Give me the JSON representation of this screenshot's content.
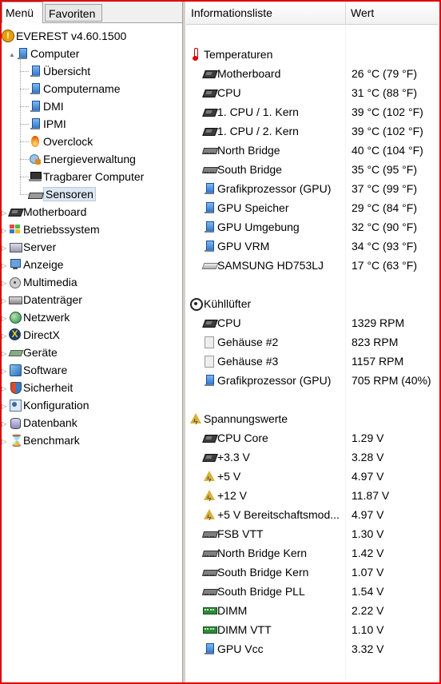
{
  "tabs": {
    "menu": "Menü",
    "favorites": "Favoriten"
  },
  "tree": {
    "root": "EVEREST v4.60.1500",
    "computer": {
      "label": "Computer",
      "children": [
        "Übersicht",
        "Computername",
        "DMI",
        "IPMI",
        "Overclock",
        "Energieverwaltung",
        "Tragbarer Computer",
        "Sensoren"
      ],
      "child_icons": [
        "computer-icon",
        "computer-icon",
        "computer-icon",
        "computer-icon",
        "overclock-flame-icon",
        "power-management-icon",
        "laptop-icon",
        "sensor-icon"
      ]
    },
    "categories": [
      "Motherboard",
      "Betriebssystem",
      "Server",
      "Anzeige",
      "Multimedia",
      "Datenträger",
      "Netzwerk",
      "DirectX",
      "Geräte",
      "Software",
      "Sicherheit",
      "Konfiguration",
      "Datenbank",
      "Benchmark"
    ],
    "category_icons": [
      "motherboard-icon",
      "windows-logo-icon",
      "server-icon",
      "display-icon",
      "multimedia-icon",
      "storage-icon",
      "network-icon",
      "directx-icon",
      "devices-icon",
      "software-icon",
      "security-shield-icon",
      "configuration-icon",
      "database-icon",
      "hourglass-icon"
    ],
    "selected": "Sensoren"
  },
  "list_header": {
    "col1": "Informationsliste",
    "col2": "Wert"
  },
  "sections": {
    "temperatures": {
      "title": "Temperaturen",
      "rows": [
        {
          "label": "Motherboard",
          "value": "26 °C  (79 °F)",
          "icon": "chip-icon"
        },
        {
          "label": "CPU",
          "value": "31 °C  (88 °F)",
          "icon": "cpu-icon"
        },
        {
          "label": "1. CPU / 1. Kern",
          "value": "39 °C  (102 °F)",
          "icon": "cpu-icon"
        },
        {
          "label": "1. CPU / 2. Kern",
          "value": "39 °C  (102 °F)",
          "icon": "cpu-icon"
        },
        {
          "label": "North Bridge",
          "value": "40 °C  (104 °F)",
          "icon": "chipset-icon"
        },
        {
          "label": "South Bridge",
          "value": "35 °C  (95 °F)",
          "icon": "chipset-icon"
        },
        {
          "label": "Grafikprozessor (GPU)",
          "value": "37 °C  (99 °F)",
          "icon": "gpu-icon"
        },
        {
          "label": "GPU Speicher",
          "value": "29 °C  (84 °F)",
          "icon": "gpu-icon"
        },
        {
          "label": "GPU Umgebung",
          "value": "32 °C  (90 °F)",
          "icon": "gpu-icon"
        },
        {
          "label": "GPU VRM",
          "value": "34 °C  (93 °F)",
          "icon": "gpu-icon"
        },
        {
          "label": "SAMSUNG HD753LJ",
          "value": "17 °C  (63 °F)",
          "icon": "hard-drive-icon"
        }
      ]
    },
    "fans": {
      "title": "Kühllüfter",
      "rows": [
        {
          "label": "CPU",
          "value": "1329 RPM",
          "icon": "cpu-icon"
        },
        {
          "label": "Gehäuse #2",
          "value": "823 RPM",
          "icon": "case-icon"
        },
        {
          "label": "Gehäuse #3",
          "value": "1157 RPM",
          "icon": "case-icon"
        },
        {
          "label": "Grafikprozessor (GPU)",
          "value": "705 RPM  (40%)",
          "icon": "gpu-icon"
        }
      ]
    },
    "voltages": {
      "title": "Spannungswerte",
      "rows": [
        {
          "label": "CPU Core",
          "value": "1.29 V",
          "icon": "cpu-icon"
        },
        {
          "label": "+3.3 V",
          "value": "3.28 V",
          "icon": "chip-icon"
        },
        {
          "label": "+5 V",
          "value": "4.97 V",
          "icon": "voltage-warning-icon"
        },
        {
          "label": "+12 V",
          "value": "11.87 V",
          "icon": "voltage-warning-icon"
        },
        {
          "label": "+5 V Bereitschaftsmod...",
          "value": "4.97 V",
          "icon": "voltage-warning-icon"
        },
        {
          "label": "FSB VTT",
          "value": "1.30 V",
          "icon": "chipset-icon"
        },
        {
          "label": "North Bridge Kern",
          "value": "1.42 V",
          "icon": "chipset-icon"
        },
        {
          "label": "South Bridge Kern",
          "value": "1.07 V",
          "icon": "chipset-icon"
        },
        {
          "label": "South Bridge PLL",
          "value": "1.54 V",
          "icon": "chipset-icon"
        },
        {
          "label": "DIMM",
          "value": "2.22 V",
          "icon": "dimm-icon"
        },
        {
          "label": "DIMM VTT",
          "value": "1.10 V",
          "icon": "dimm-icon"
        },
        {
          "label": "GPU Vcc",
          "value": "3.32 V",
          "icon": "gpu-icon"
        }
      ]
    }
  },
  "colors": {
    "frame": "#e00000",
    "selection": "#dde7f3"
  }
}
